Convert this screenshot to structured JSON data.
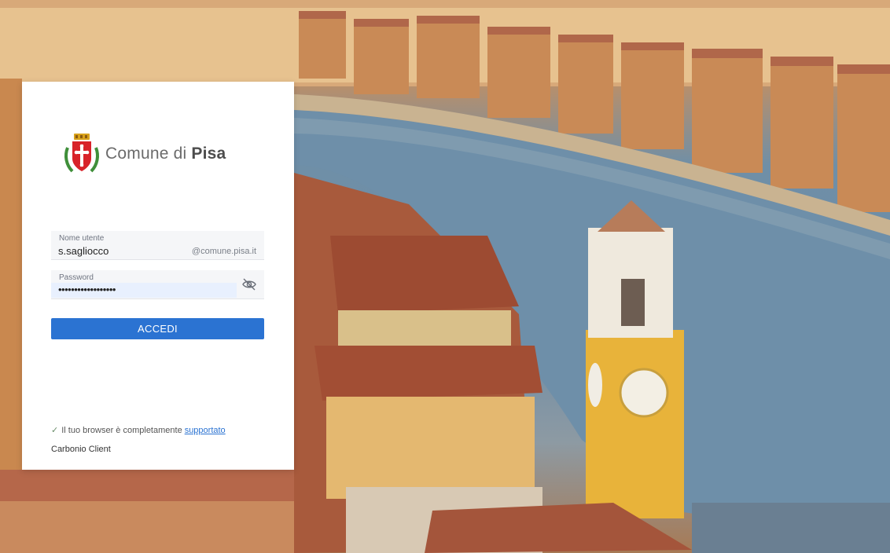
{
  "logo": {
    "text_prefix": "Comune di",
    "text_bold": "Pisa",
    "crest_icon": "pisa-crest-icon"
  },
  "login": {
    "username_label": "Nome utente",
    "username_value": "s.sagliocco",
    "username_suffix": "@comune.pisa.it",
    "password_label": "Password",
    "password_value": "••••••••••••••••••",
    "eye_icon": "eye-off-icon",
    "submit_label": "ACCEDI"
  },
  "footer": {
    "support_text": "Il tuo browser è completamente",
    "support_link": "supportato",
    "client_name": "Carbonio Client"
  },
  "colors": {
    "accent": "#2b73d2",
    "field_bg": "#f5f6f8",
    "autofill_bg": "#e8f0fe"
  }
}
